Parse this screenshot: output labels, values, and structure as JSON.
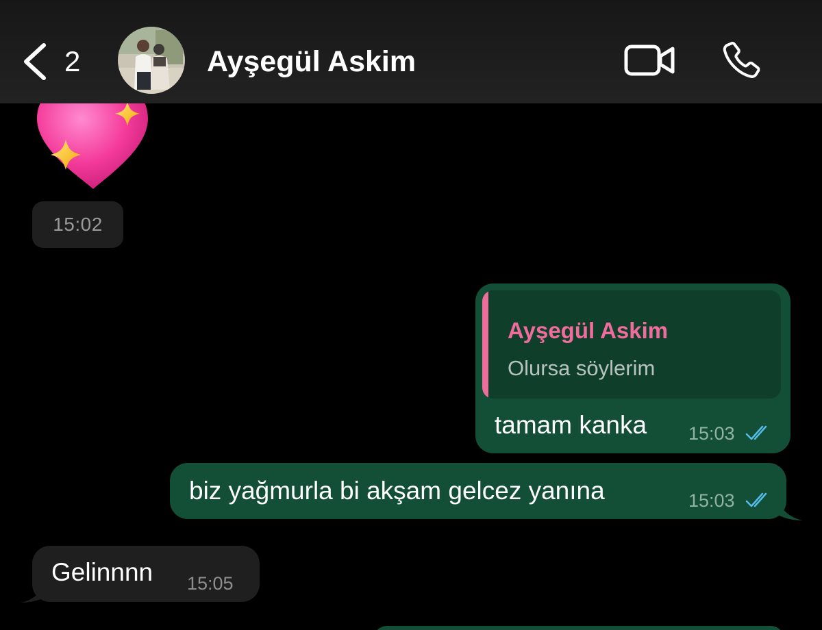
{
  "header": {
    "back_count": "2",
    "contact_name": "Ayşegül Askim"
  },
  "messages": [
    {
      "id": "emoji",
      "direction": "incoming",
      "emoji": "sparkling-heart",
      "time": "15:02"
    },
    {
      "id": "reply",
      "direction": "outgoing",
      "quote": {
        "author": "Ayşegül Askim",
        "text": "Olursa söylerim"
      },
      "text": "tamam kanka",
      "time": "15:03",
      "status": "read"
    },
    {
      "id": "msg2",
      "direction": "outgoing",
      "text": "biz yağmurla bi akşam gelcez yanına",
      "time": "15:03",
      "status": "read"
    },
    {
      "id": "msg3",
      "direction": "incoming",
      "text": "Gelinnnn",
      "time": "15:05"
    }
  ],
  "icons": {
    "back": "chevron-left-icon",
    "video": "video-camera-icon",
    "call": "phone-icon",
    "read_ticks": "double-check-icon"
  },
  "colors": {
    "header_bg": "#1c1c1c",
    "chat_bg": "#000000",
    "outgoing_bubble": "#134e36",
    "incoming_bubble": "#1f1f1f",
    "quote_accent": "#ef6d9c",
    "read_ticks": "#53bdeb"
  }
}
